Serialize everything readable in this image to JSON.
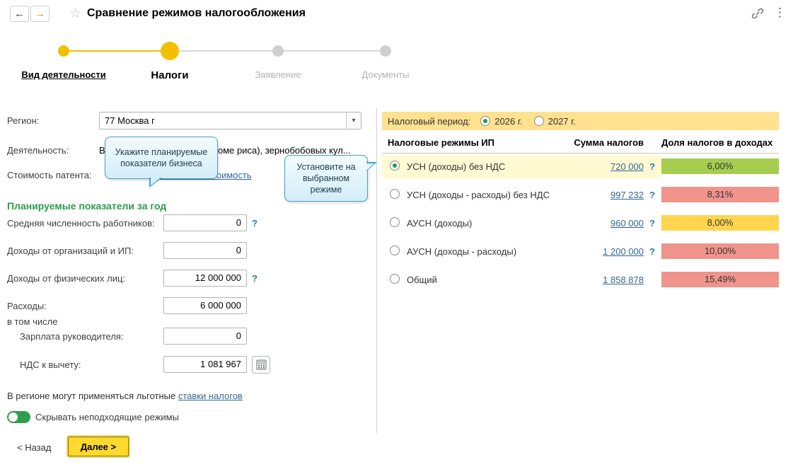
{
  "header": {
    "title": "Сравнение режимов налогообложения",
    "back_icon": "←",
    "forward_icon": "→",
    "star_icon": "☆",
    "menu_icon": "⋮"
  },
  "wizard": {
    "steps": [
      {
        "label": "Вид деятельности",
        "state": "done"
      },
      {
        "label": "Налоги",
        "state": "current"
      },
      {
        "label": "Заявление",
        "state": "pending"
      },
      {
        "label": "Документы",
        "state": "pending"
      }
    ]
  },
  "form": {
    "region_label": "Регион:",
    "region_value": "77 Москва г",
    "combo_arrow": "▾",
    "activity_label": "Деятельность:",
    "activity_value": "Выращивание зерновых (кроме риса), зернобобовых кул...",
    "patent_label": "Стоимость патента:",
    "patent_link": "Рассчитать стоимость",
    "indicators_title": "Планируемые показатели за год",
    "fields": [
      {
        "label": "Средняя численность работников:",
        "value": "0",
        "help": "?"
      },
      {
        "label": "Доходы от организаций и ИП:",
        "value": "0",
        "help": ""
      },
      {
        "label": "Доходы от физических лиц:",
        "value": "12 000 000",
        "help": "?"
      },
      {
        "label": "Расходы:",
        "value": "6 000 000",
        "help": ""
      },
      {
        "label": "Зарплата руководителя:",
        "value": "0",
        "help": ""
      },
      {
        "label": "НДС к вычету:",
        "value": "1 081 967",
        "help": ""
      }
    ],
    "including_label": "в том числе",
    "benefits_text": "В регионе могут применяться льготные ",
    "benefits_link": "ставки налогов",
    "toggle_label": "Скрывать неподходящие режимы",
    "back_button": "< Назад",
    "next_button": "Далее >"
  },
  "tooltips": {
    "left": "Укажите планируемые показатели бизнеса",
    "right": "Установите на выбранном режиме"
  },
  "comparison": {
    "period_label": "Налоговый период:",
    "periods": [
      {
        "label": "2026 г.",
        "selected": true
      },
      {
        "label": "2027 г.",
        "selected": false
      }
    ],
    "columns": [
      "Налоговые режимы ИП",
      "Сумма налогов",
      "Доля налогов в доходах"
    ],
    "rows": [
      {
        "name": "УСН (доходы) без НДС",
        "sum": "720 000",
        "help": "?",
        "share": "6,00%",
        "badge": "green",
        "selected": true
      },
      {
        "name": "УСН (доходы - расходы) без НДС",
        "sum": "997 232",
        "help": "?",
        "share": "8,31%",
        "badge": "red",
        "selected": false
      },
      {
        "name": "АУСН (доходы)",
        "sum": "960 000",
        "help": "?",
        "share": "8,00%",
        "badge": "yellow",
        "selected": false
      },
      {
        "name": "АУСН (доходы - расходы)",
        "sum": "1 200 000",
        "help": "?",
        "share": "10,00%",
        "badge": "red",
        "selected": false
      },
      {
        "name": "Общий",
        "sum": "1 858 878",
        "help": "",
        "share": "15,49%",
        "badge": "red",
        "selected": false
      }
    ]
  },
  "colors": {
    "badges": {
      "green": "#a5cd50",
      "red": "#f0938b",
      "yellow": "#ffd54f"
    },
    "accent_yellow": "#f2c000",
    "toggle_on": "#2ca04c",
    "link": "#336699",
    "period_bar": "#ffe18f",
    "selected_row": "#fffad2"
  }
}
